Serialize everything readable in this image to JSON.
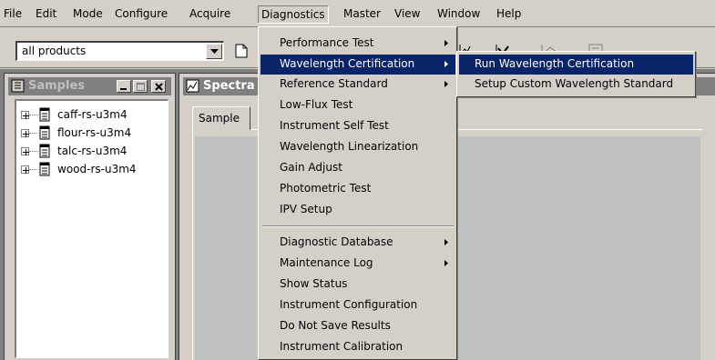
{
  "menubar": {
    "items": [
      {
        "label": "File"
      },
      {
        "label": "Edit"
      },
      {
        "label": "Mode"
      },
      {
        "label": "Configure"
      },
      {
        "label": "Acquire"
      },
      {
        "label": "Diagnostics"
      },
      {
        "label": "Master"
      },
      {
        "label": "View"
      },
      {
        "label": "Window"
      },
      {
        "label": "Help"
      }
    ],
    "open_menu": "Diagnostics"
  },
  "toolbar": {
    "product_select": {
      "value": "all products"
    },
    "buttons": [
      {
        "icon": "new-document-icon"
      },
      {
        "icon": "chart-icon"
      },
      {
        "icon": "peak-icon"
      },
      {
        "icon": "graph-icon"
      },
      {
        "icon": "report-icon"
      }
    ]
  },
  "samples_window": {
    "title": "Samples",
    "items": [
      {
        "label": "caff-rs-u3m4"
      },
      {
        "label": "flour-rs-u3m4"
      },
      {
        "label": "talc-rs-u3m4"
      },
      {
        "label": "wood-rs-u3m4"
      }
    ]
  },
  "spectra_window": {
    "title": "Spectra",
    "tab_label": "Sample"
  },
  "diagnostics_menu": {
    "items": [
      {
        "label": "Performance Test",
        "submenu": true
      },
      {
        "label": "Wavelength Certification",
        "submenu": true,
        "highlighted": true
      },
      {
        "label": "Reference Standard",
        "submenu": true
      },
      {
        "label": "Low-Flux Test"
      },
      {
        "label": "Instrument Self Test"
      },
      {
        "label": "Wavelength Linearization"
      },
      {
        "label": "Gain Adjust"
      },
      {
        "label": "Photometric Test"
      },
      {
        "label": "IPV Setup"
      },
      {
        "label": "Diagnostic Database",
        "submenu": true
      },
      {
        "label": "Maintenance Log",
        "submenu": true
      },
      {
        "label": "Show Status"
      },
      {
        "label": "Instrument Configuration"
      },
      {
        "label": "Do Not Save Results"
      },
      {
        "label": "Instrument Calibration"
      }
    ]
  },
  "wavelength_submenu": {
    "items": [
      {
        "label": "Run Wavelength Certification",
        "highlighted": true
      },
      {
        "label": "Setup Custom Wavelength Standard"
      }
    ]
  },
  "colors": {
    "menu_highlight": "#0a246a",
    "face": "#d4d0c8",
    "mdi_background": "#808080"
  }
}
